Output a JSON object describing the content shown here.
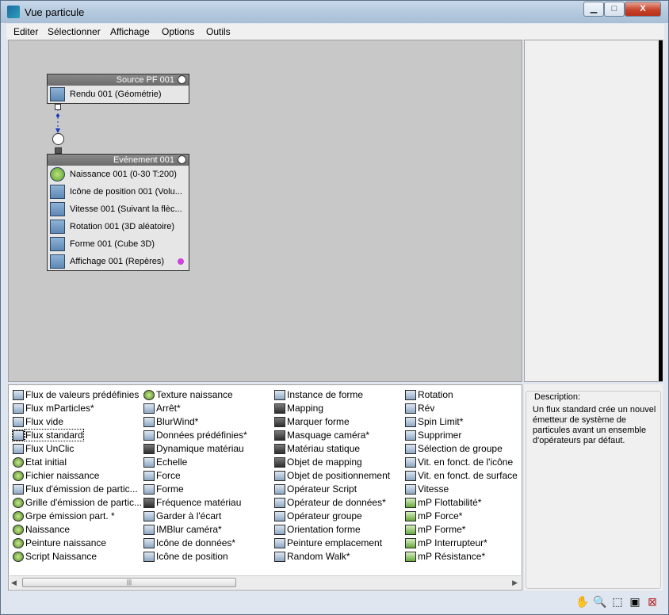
{
  "window": {
    "title": "Vue particule"
  },
  "window_buttons": {
    "minimize": "▁",
    "maximize": "□",
    "close": "X"
  },
  "menu": [
    "Editer",
    "Sélectionner",
    "Affichage",
    "Options",
    "Outils"
  ],
  "source_node": {
    "title": "Source PF 001",
    "operators": [
      {
        "label": "Rendu 001 (Géométrie)",
        "icon": "teapot-icon"
      }
    ]
  },
  "event_node": {
    "title": "Evénement 001",
    "operators": [
      {
        "label": "Naissance 001 (0-30 T:200)",
        "icon": "birth-icon"
      },
      {
        "label": "Icône de position 001 (Volu...",
        "icon": "position-icon"
      },
      {
        "label": "Vitesse 001 (Suivant la flèc...",
        "icon": "speed-icon"
      },
      {
        "label": "Rotation 001 (3D aléatoire)",
        "icon": "rotation-icon"
      },
      {
        "label": "Forme 001 (Cube 3D)",
        "icon": "shape-icon"
      },
      {
        "label": "Affichage 001 (Repères)",
        "icon": "display-icon"
      }
    ],
    "display_color": "#cc44dd"
  },
  "depot": {
    "columns": [
      [
        "Flux de valeurs prédéfinies",
        "Flux mParticles*",
        "Flux vide",
        "Flux standard",
        "Flux UnClic",
        "Etat initial",
        "Fichier naissance",
        "Flux d'émission de partic...",
        "Grille d'émission de partic...",
        "Grpe émission part. *",
        "Naissance",
        "Peinture naissance",
        "Script Naissance"
      ],
      [
        "Texture naissance",
        "Arrêt*",
        "BlurWind*",
        "Données prédéfinies*",
        "Dynamique matériau",
        "Echelle",
        "Force",
        "Forme",
        "Fréquence matériau",
        "Garder à l'écart",
        "IMBlur caméra*",
        "Icône de données*",
        "Icône de position"
      ],
      [
        "Instance de forme",
        "Mapping",
        "Marquer forme",
        "Masquage caméra*",
        "Matériau statique",
        "Objet de mapping",
        "Objet de positionnement",
        "Opérateur Script",
        "Opérateur de données*",
        "Opérateur groupe",
        "Orientation forme",
        "Peinture emplacement",
        "Random Walk*"
      ],
      [
        "Rotation",
        "Rév",
        "Spin Limit*",
        "Supprimer",
        "Sélection de groupe",
        "Vit. en fonct. de l'icône",
        "Vit. en fonct. de surface",
        "Vitesse",
        "mP Flottabilité*",
        "mP Force*",
        "mP Forme*",
        "mP Interrupteur*",
        "mP Résistance*"
      ]
    ],
    "selected": "Flux standard",
    "scroll_grip": "|||"
  },
  "description": {
    "legend": "Description:",
    "text": "Un flux standard crée un nouvel émetteur de système de particules avant un ensemble d'opérateurs par défaut."
  },
  "nav_icons": [
    "pan-icon",
    "zoom-icon",
    "zoom-region-icon",
    "zoom-extents-icon",
    "no-zoom-icon"
  ]
}
